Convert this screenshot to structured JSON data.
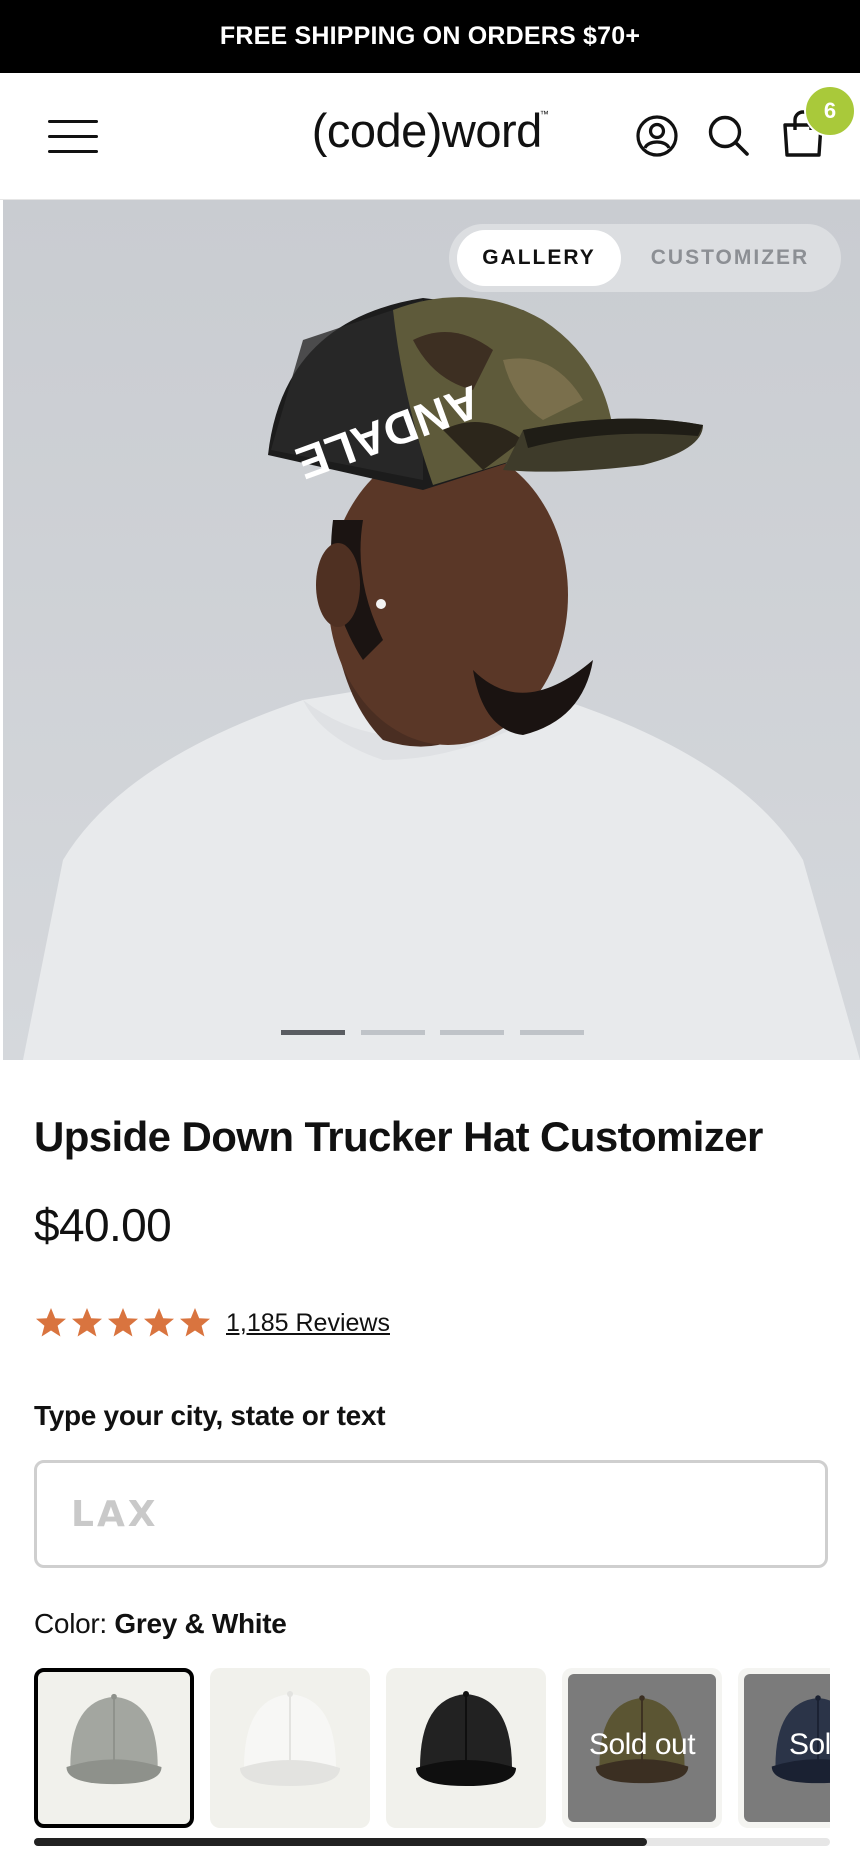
{
  "announcement": "FREE SHIPPING ON ORDERS $70+",
  "header": {
    "logo": "(code)word",
    "logo_mark": "™",
    "cart_count": "6",
    "badge_color": "#a9c93a"
  },
  "gallery": {
    "tabs": [
      "GALLERY",
      "CUSTOMIZER"
    ],
    "active_tab": "GALLERY",
    "slides_total": 4,
    "active_slide": 1
  },
  "product": {
    "title": "Upside Down Trucker Hat Customizer",
    "price": "$40.00",
    "rating": 5,
    "reviews_text": "1,185 Reviews",
    "star_color": "#d9743f"
  },
  "customizer": {
    "field_label": "Type your city, state or text",
    "input_value": "",
    "input_placeholder": "LAX",
    "color_label": "Color:",
    "color_value": "Grey & White",
    "swatches": [
      {
        "color": "Grey & White",
        "icon": "grey-cap-icon",
        "sold_out": false,
        "selected": true
      },
      {
        "color": "White",
        "icon": "white-cap-icon",
        "sold_out": false,
        "selected": false
      },
      {
        "color": "Black",
        "icon": "black-cap-icon",
        "sold_out": false,
        "selected": false
      },
      {
        "color": "Camo",
        "icon": "camo-cap-icon",
        "sold_out": true,
        "label": "Sold out",
        "selected": false
      },
      {
        "color": "Navy",
        "icon": "navy-cap-icon",
        "sold_out": true,
        "label": "Sold",
        "selected": false
      }
    ],
    "scroll_progress": 0.77
  }
}
